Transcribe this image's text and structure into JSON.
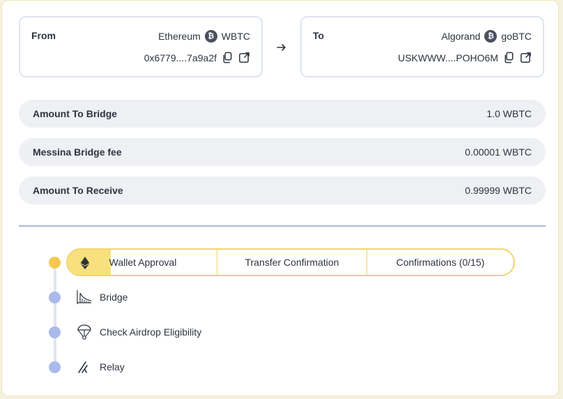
{
  "from": {
    "label": "From",
    "network": "Ethereum",
    "token": "WBTC",
    "address": "0x6779....7a9a2f",
    "coin_icon": "bitcoin-icon"
  },
  "to": {
    "label": "To",
    "network": "Algorand",
    "token": "goBTC",
    "address": "USKWWW....POHO6M",
    "coin_icon": "bitcoin-icon"
  },
  "summary": [
    {
      "key": "Amount To Bridge",
      "value": "1.0 WBTC"
    },
    {
      "key": "Messina Bridge fee",
      "value": "0.00001 WBTC"
    },
    {
      "key": "Amount To Receive",
      "value": "0.99999 WBTC"
    }
  ],
  "progress": {
    "tabs": [
      {
        "label": "Wallet Approval",
        "icon": "ethereum-icon"
      },
      {
        "label": "Transfer Confirmation"
      },
      {
        "label": "Confirmations (0/15)"
      }
    ],
    "steps": [
      {
        "label": "Bridge",
        "icon": "bridge-icon"
      },
      {
        "label": "Check Airdrop Eligibility",
        "icon": "parachute-icon"
      },
      {
        "label": "Relay",
        "icon": "relay-icon"
      }
    ]
  },
  "colors": {
    "accent_yellow": "#f5c94e",
    "step_dot": "#a9baeb",
    "row_bg": "#eef0f3",
    "card_border": "#dfe5f2"
  }
}
